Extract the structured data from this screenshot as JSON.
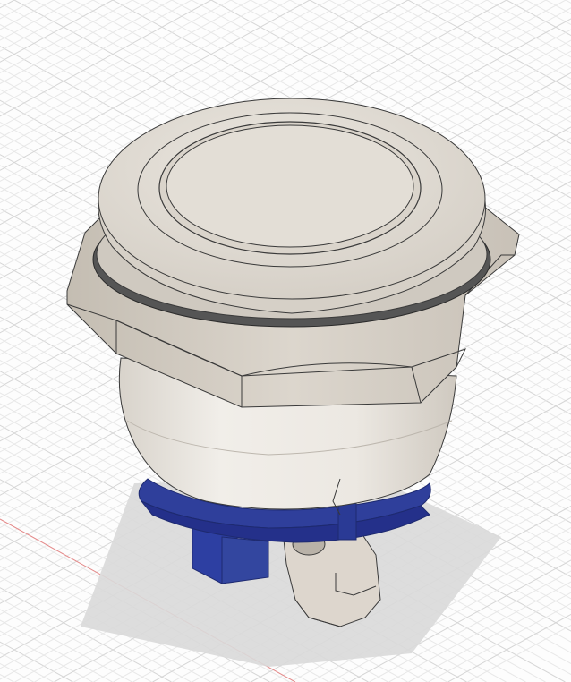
{
  "viewport": {
    "background_color": "#fdfdfd",
    "grid_minor_color": "#e8e8e8",
    "grid_major_color": "#d6d6d6",
    "axis_color": "#e48a8a",
    "shadow_color": "#d9d9d9"
  },
  "model": {
    "body_color": "#e9e5df",
    "body_shade_color": "#cfcac2",
    "nut_color": "#ddd7cf",
    "nut_shade_color": "#c9c2b8",
    "cap_color": "#dcd6ce",
    "base_ring_color": "#2f3f9b",
    "base_ring_dark_color": "#24308a",
    "terminal_color": "#2d3fa2",
    "edge_color": "#3a3a3a"
  }
}
